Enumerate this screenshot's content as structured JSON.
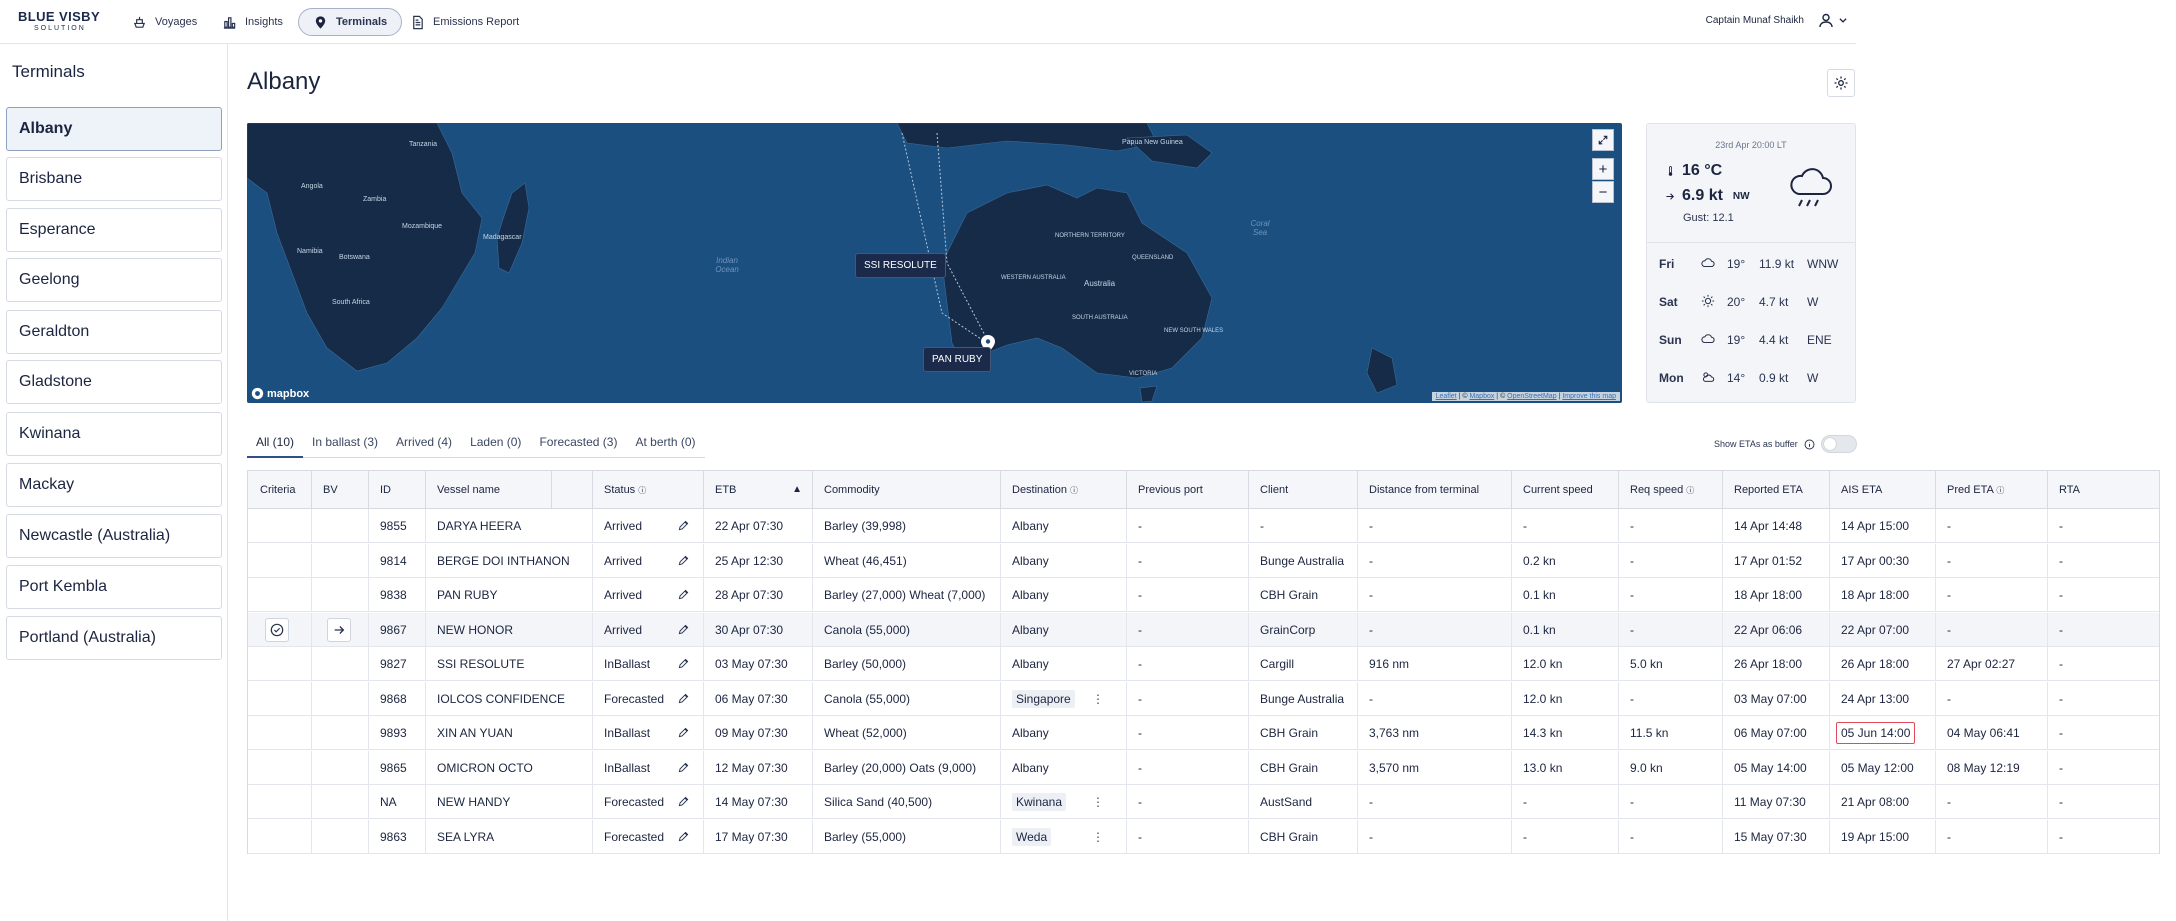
{
  "brand": {
    "line1": "BLUE VISBY",
    "line2": "SOLUTION"
  },
  "nav": {
    "voyages": "Voyages",
    "insights": "Insights",
    "terminals": "Terminals",
    "emissions": "Emissions Report",
    "user": "Captain Munaf Shaikh"
  },
  "sidebar": {
    "title": "Terminals",
    "items": [
      "Albany",
      "Brisbane",
      "Esperance",
      "Geelong",
      "Geraldton",
      "Gladstone",
      "Kwinana",
      "Mackay",
      "Newcastle (Australia)",
      "Port Kembla",
      "Portland (Australia)"
    ]
  },
  "page": {
    "title": "Albany"
  },
  "map": {
    "vessel_labels": [
      "SSI RESOLUTE",
      "PAN RUBY"
    ],
    "logo": "mapbox",
    "attribution": {
      "leaflet": "Leaflet",
      "sep1": " | © ",
      "mapbox": "Mapbox",
      "sep2": " | © ",
      "osm": "OpenStreetMap",
      "sep3": " | ",
      "improve": "Improve this map"
    },
    "labels": {
      "tanzania": "Tanzania",
      "angola": "Angola",
      "zambia": "Zambia",
      "mozambique": "Mozambique",
      "namibia": "Namibia",
      "botswana": "Botswana",
      "south_africa": "South Africa",
      "madagascar": "Madagascar",
      "indian_ocean": "Indian Ocean",
      "australia": "Australia",
      "papua": "Papua New Guinea",
      "coral_sea": "Coral Sea",
      "western_australia": "WESTERN AUSTRALIA",
      "south_australia": "SOUTH AUSTRALIA",
      "nsw": "NEW SOUTH WALES",
      "victoria": "VICTORIA",
      "northern_territory": "NORTHERN TERRITORY",
      "queensland": "QUEENSLAND"
    }
  },
  "weather": {
    "date": "23rd Apr 20:00 LT",
    "temp": "16 °C",
    "wind": "6.9 kt",
    "wind_dir": "NW",
    "gust": "Gust: 12.1",
    "forecast": [
      {
        "day": "Fri",
        "temp": "19°",
        "speed": "11.9 kt",
        "dir": "WNW",
        "icon": "cloud-icon"
      },
      {
        "day": "Sat",
        "temp": "20°",
        "speed": "4.7 kt",
        "dir": "W",
        "icon": "sun-icon"
      },
      {
        "day": "Sun",
        "temp": "19°",
        "speed": "4.4 kt",
        "dir": "ENE",
        "icon": "cloud-icon"
      },
      {
        "day": "Mon",
        "temp": "14°",
        "speed": "0.9 kt",
        "dir": "W",
        "icon": "partly-cloudy-icon"
      }
    ]
  },
  "tabs": [
    "All (10)",
    "In ballast (3)",
    "Arrived (4)",
    "Laden (0)",
    "Forecasted (3)",
    "At berth (0)"
  ],
  "toggle_label": "Show ETAs as buffer",
  "table": {
    "headers": [
      "Criteria",
      "BV",
      "ID",
      "Vessel name",
      "",
      "Status",
      "ETB",
      "Commodity",
      "Destination",
      "Previous port",
      "Client",
      "Distance from terminal",
      "Current speed",
      "Req speed",
      "Reported ETA",
      "AIS ETA",
      "Pred ETA",
      "RTA"
    ],
    "rows": [
      {
        "id": "9855",
        "name": "DARYA HEERA",
        "status": "Arrived",
        "etb": "22 Apr 07:30",
        "commodity": "Barley (39,998)",
        "dest": "Albany",
        "prev": "-",
        "client": "-",
        "dist": "-",
        "cur": "-",
        "req": "-",
        "rep": "14 Apr 14:48",
        "ais": "14 Apr 15:00",
        "pred": "-",
        "rta": "-"
      },
      {
        "id": "9814",
        "name": "BERGE DOI INTHANON",
        "status": "Arrived",
        "etb": "25 Apr 12:30",
        "commodity": "Wheat (46,451)",
        "dest": "Albany",
        "prev": "-",
        "client": "Bunge Australia",
        "dist": "-",
        "cur": "0.2 kn",
        "req": "-",
        "rep": "17 Apr 01:52",
        "ais": "17 Apr 00:30",
        "pred": "-",
        "rta": "-"
      },
      {
        "id": "9838",
        "name": "PAN RUBY",
        "status": "Arrived",
        "etb": "28 Apr 07:30",
        "commodity": "Barley (27,000) Wheat (7,000)",
        "dest": "Albany",
        "prev": "-",
        "client": "CBH Grain",
        "dist": "-",
        "cur": "0.1 kn",
        "req": "-",
        "rep": "18 Apr 18:00",
        "ais": "18 Apr 18:00",
        "pred": "-",
        "rta": "-"
      },
      {
        "id": "9867",
        "name": "NEW HONOR",
        "status": "Arrived",
        "etb": "30 Apr 07:30",
        "commodity": "Canola (55,000)",
        "dest": "Albany",
        "prev": "-",
        "client": "GrainCorp",
        "dist": "-",
        "cur": "0.1 kn",
        "req": "-",
        "rep": "22 Apr 06:06",
        "ais": "22 Apr 07:00",
        "pred": "-",
        "rta": "-"
      },
      {
        "id": "9827",
        "name": "SSI RESOLUTE",
        "status": "InBallast",
        "etb": "03 May 07:30",
        "commodity": "Barley (50,000)",
        "dest": "Albany",
        "prev": "-",
        "client": "Cargill",
        "dist": "916 nm",
        "cur": "12.0 kn",
        "req": "5.0 kn",
        "rep": "26 Apr 18:00",
        "ais": "26 Apr 18:00",
        "pred": "27 Apr 02:27",
        "rta": "-"
      },
      {
        "id": "9868",
        "name": "IOLCOS CONFIDENCE",
        "status": "Forecasted",
        "etb": "06 May 07:30",
        "commodity": "Canola (55,000)",
        "dest": "Singapore",
        "prev": "-",
        "client": "Bunge Australia",
        "dist": "-",
        "cur": "12.0 kn",
        "req": "-",
        "rep": "03 May 07:00",
        "ais": "24 Apr 13:00",
        "pred": "-",
        "rta": "-"
      },
      {
        "id": "9893",
        "name": "XIN AN YUAN",
        "status": "InBallast",
        "etb": "09 May 07:30",
        "commodity": "Wheat (52,000)",
        "dest": "Albany",
        "prev": "-",
        "client": "CBH Grain",
        "dist": "3,763 nm",
        "cur": "14.3 kn",
        "req": "11.5 kn",
        "rep": "06 May 07:00",
        "ais": "05 Jun 14:00",
        "pred": "04 May 06:41",
        "rta": "-"
      },
      {
        "id": "9865",
        "name": "OMICRON OCTO",
        "status": "InBallast",
        "etb": "12 May 07:30",
        "commodity": "Barley (20,000) Oats (9,000)",
        "dest": "Albany",
        "prev": "-",
        "client": "CBH Grain",
        "dist": "3,570 nm",
        "cur": "13.0 kn",
        "req": "9.0 kn",
        "rep": "05 May 14:00",
        "ais": "05 May 12:00",
        "pred": "08 May 12:19",
        "rta": "-"
      },
      {
        "id": "NA",
        "name": "NEW HANDY",
        "status": "Forecasted",
        "etb": "14 May 07:30",
        "commodity": "Silica Sand (40,500)",
        "dest": "Kwinana",
        "prev": "-",
        "client": "AustSand",
        "dist": "-",
        "cur": "-",
        "req": "-",
        "rep": "11 May 07:30",
        "ais": "21 Apr 08:00",
        "pred": "-",
        "rta": "-"
      },
      {
        "id": "9863",
        "name": "SEA LYRA",
        "status": "Forecasted",
        "etb": "17 May 07:30",
        "commodity": "Barley (55,000)",
        "dest": "Weda",
        "prev": "-",
        "client": "CBH Grain",
        "dist": "-",
        "cur": "-",
        "req": "-",
        "rep": "15 May 07:30",
        "ais": "19 Apr 15:00",
        "pred": "-",
        "rta": "-"
      }
    ]
  }
}
